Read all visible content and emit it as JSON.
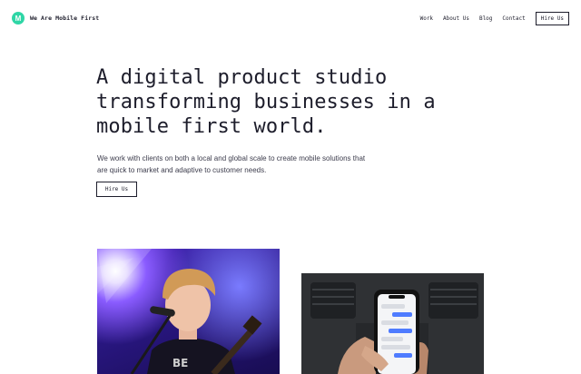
{
  "header": {
    "logo_letter": "M",
    "brand": "We Are Mobile First",
    "nav": [
      {
        "label": "Work"
      },
      {
        "label": "About Us"
      },
      {
        "label": "Blog"
      },
      {
        "label": "Contact"
      }
    ],
    "cta": "Hire Us"
  },
  "hero": {
    "title": "A digital product studio transforming businesses in a mobile first world.",
    "description": "We work with clients on both a local and global scale to create mobile solutions that are quick to market and adaptive to customer needs.",
    "cta": "Hire Us"
  },
  "colors": {
    "accent": "#2fd6a6",
    "text": "#1d1d2b"
  },
  "images": [
    {
      "name": "concert-photo"
    },
    {
      "name": "phone-in-car-photo"
    }
  ]
}
